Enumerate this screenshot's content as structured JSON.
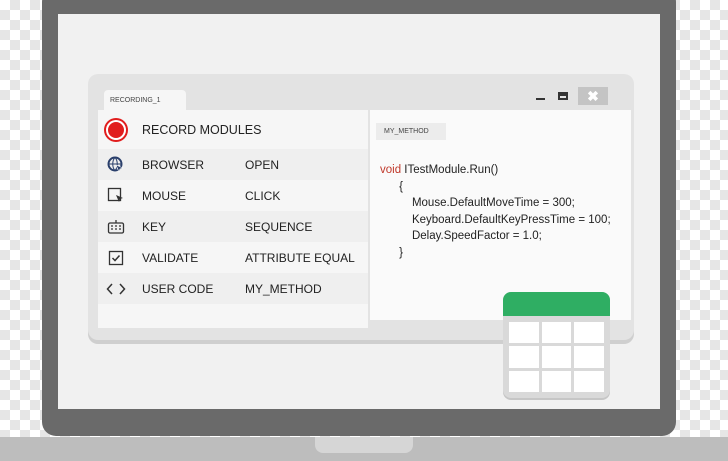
{
  "window": {
    "title_tab": "RECORDING_1",
    "controls": {
      "minimize": "minimize",
      "maximize": "maximize",
      "close": "✖"
    }
  },
  "modules": {
    "header": "RECORD MODULES",
    "rows": [
      {
        "icon": "cursor-globe-icon",
        "name": "BROWSER",
        "value": "OPEN"
      },
      {
        "icon": "click-icon",
        "name": "MOUSE",
        "value": "CLICK"
      },
      {
        "icon": "keyboard-icon",
        "name": "KEY",
        "value": "SEQUENCE"
      },
      {
        "icon": "checkbox-icon",
        "name": "VALIDATE",
        "value": "ATTRIBUTE EQUAL"
      },
      {
        "icon": "code-brackets-icon",
        "name": "USER CODE",
        "value": "MY_METHOD"
      }
    ]
  },
  "editor": {
    "tab": "MY_METHOD",
    "code": {
      "keyword": "void",
      "signature": " ITestModule.Run()",
      "open_brace": "{",
      "line1": "Mouse.DefaultMoveTime = 300;",
      "line2": "Keyboard.DefaultKeyPressTime = 100;",
      "line3": "Delay.SpeedFactor = 1.0;",
      "close_brace": "}"
    }
  },
  "colors": {
    "record_red": "#e11d1d",
    "table_green": "#2fae63",
    "frame_gray": "#6a6a6a"
  }
}
